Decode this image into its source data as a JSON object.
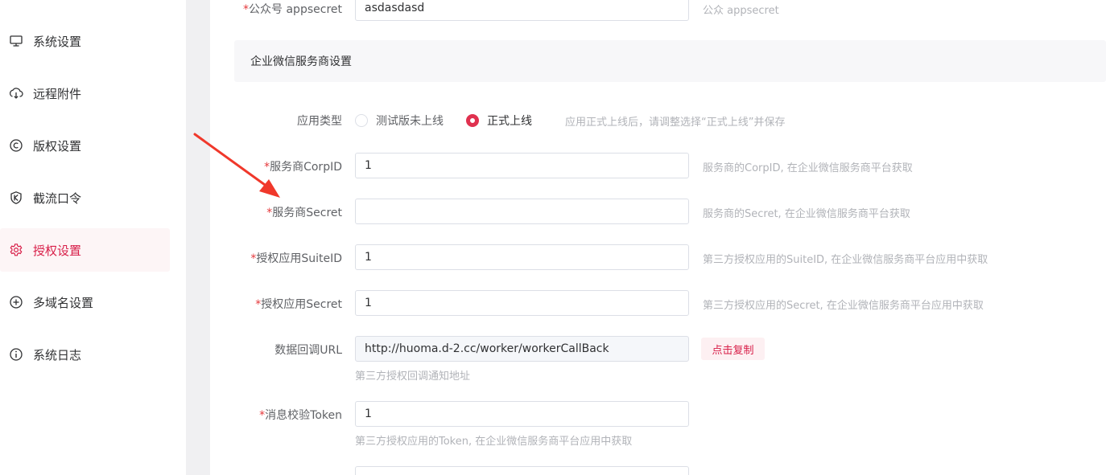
{
  "sidebar": {
    "items": [
      {
        "label": "系统设置",
        "icon": "monitor-icon",
        "active": false
      },
      {
        "label": "远程附件",
        "icon": "cloud-download-icon",
        "active": false
      },
      {
        "label": "版权设置",
        "icon": "copyright-icon",
        "active": false
      },
      {
        "label": "截流口令",
        "icon": "k-shield-icon",
        "active": false
      },
      {
        "label": "授权设置",
        "icon": "gear-icon",
        "active": true
      },
      {
        "label": "多域名设置",
        "icon": "plus-circle-icon",
        "active": false
      },
      {
        "label": "系统日志",
        "icon": "info-icon",
        "active": false
      }
    ]
  },
  "form": {
    "appsecret": {
      "label": "公众号 appsecret",
      "value": "asdasdasd",
      "hint": "公众 appsecret"
    },
    "section_title": "企业微信服务商设置",
    "app_type": {
      "label": "应用类型",
      "options": [
        "测试版未上线",
        "正式上线"
      ],
      "selected": "正式上线",
      "hint": "应用正式上线后，请调整选择“正式上线”并保存"
    },
    "corp_id": {
      "label": "服务商CorpID",
      "value": "1",
      "hint": "服务商的CorpID, 在企业微信服务商平台获取"
    },
    "provider_secret": {
      "label": "服务商Secret",
      "value": "",
      "hint": "服务商的Secret, 在企业微信服务商平台获取"
    },
    "suite_id": {
      "label": "授权应用SuiteID",
      "value": "1",
      "hint": "第三方授权应用的SuiteID, 在企业微信服务商平台应用中获取"
    },
    "suite_secret": {
      "label": "授权应用Secret",
      "value": "1",
      "hint": "第三方授权应用的Secret, 在企业微信服务商平台应用中获取"
    },
    "callback_url": {
      "label": "数据回调URL",
      "value": "http://huoma.d-2.cc/worker/workerCallBack",
      "copy_label": "点击复制",
      "hint": "第三方授权回调通知地址"
    },
    "token": {
      "label": "消息校验Token",
      "value": "1",
      "hint": "第三方授权应用的Token, 在企业微信服务商平台应用中获取"
    }
  },
  "colors": {
    "accent": "#d81e48",
    "annotation_arrow": "#f0382b"
  }
}
